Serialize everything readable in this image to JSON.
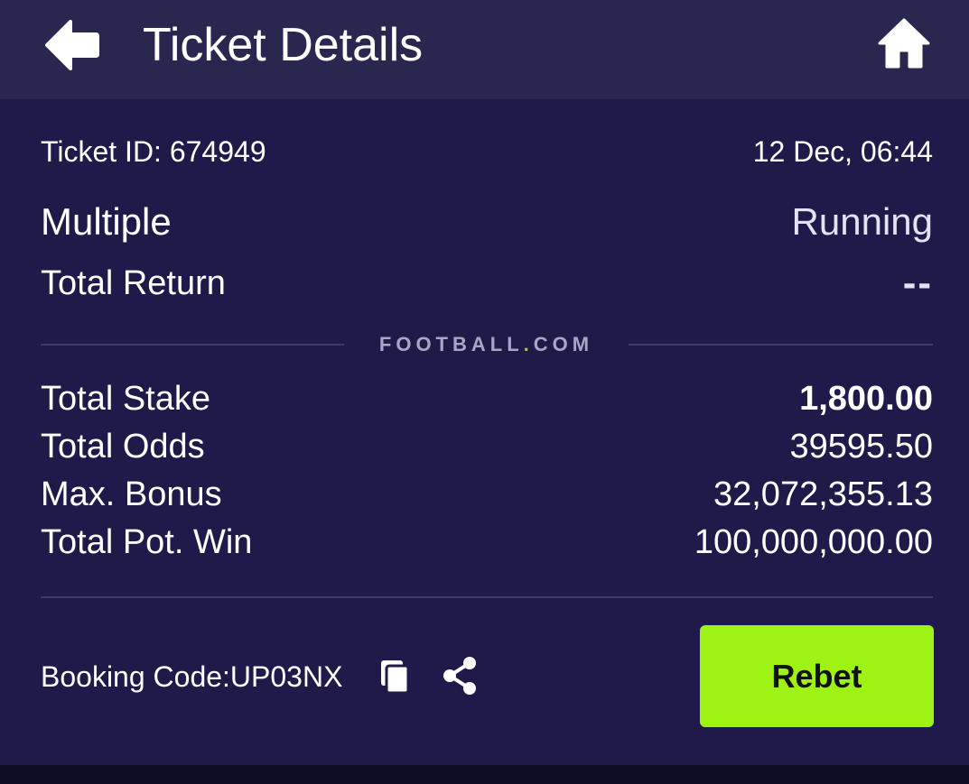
{
  "header": {
    "title": "Ticket Details",
    "back_icon": "arrow-left-icon",
    "home_icon": "home-icon"
  },
  "ticket": {
    "id_text": "Ticket ID: 674949",
    "datetime": "12 Dec, 06:44",
    "bet_type": "Multiple",
    "status": "Running",
    "total_return_label": "Total Return",
    "total_return_value": "--"
  },
  "brand": {
    "part1": "FOOTBALL",
    "dot": ".",
    "part2": "COM"
  },
  "stats": [
    {
      "label": "Total Stake",
      "value": "1,800.00"
    },
    {
      "label": "Total Odds",
      "value": "39595.50"
    },
    {
      "label": "Max. Bonus",
      "value": "32,072,355.13"
    },
    {
      "label": "Total Pot. Win",
      "value": "100,000,000.00"
    }
  ],
  "footer": {
    "booking_code": "Booking Code:UP03NX",
    "copy_icon": "copy-icon",
    "share_icon": "share-icon",
    "rebet_label": "Rebet"
  },
  "colors": {
    "background": "#1f1a4a",
    "header": "#29264f",
    "accent": "#9ef214",
    "brand_dot": "#8cdf1a"
  }
}
